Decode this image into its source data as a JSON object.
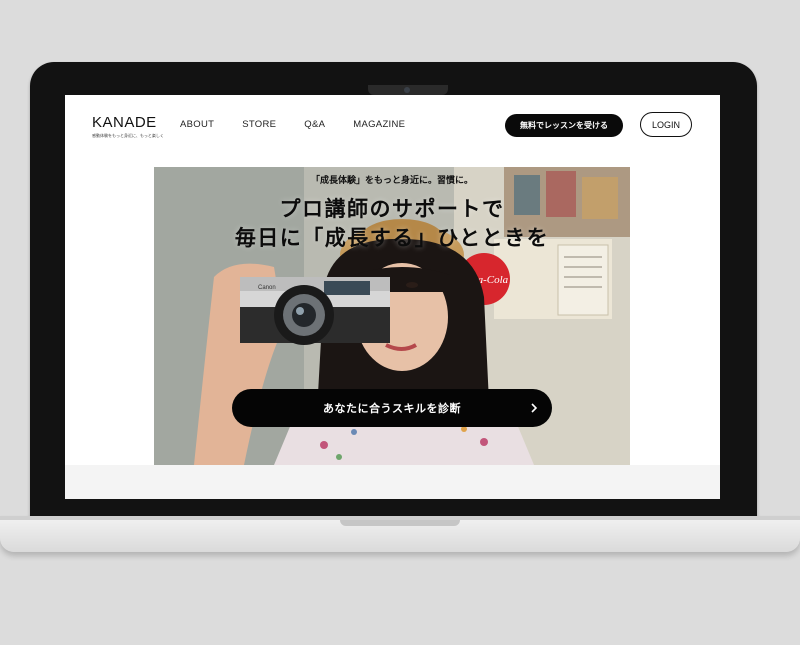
{
  "header": {
    "logo": "KANADE",
    "logo_sub": "感動体験をもっと身近に、もっと楽しく",
    "nav": [
      "ABOUT",
      "STORE",
      "Q&A",
      "MAGAZINE"
    ],
    "cta_label": "無料でレッスンを受ける",
    "login_label": "LOGIN"
  },
  "hero": {
    "tagline": "「成長体験」をもっと身近に。習慣に。",
    "title_line1": "プロ講師のサポートで",
    "title_line2": "毎日に「成長する」ひとときを",
    "button_label": "あなたに合うスキルを診断",
    "poster_text": "Coca-Cola"
  }
}
